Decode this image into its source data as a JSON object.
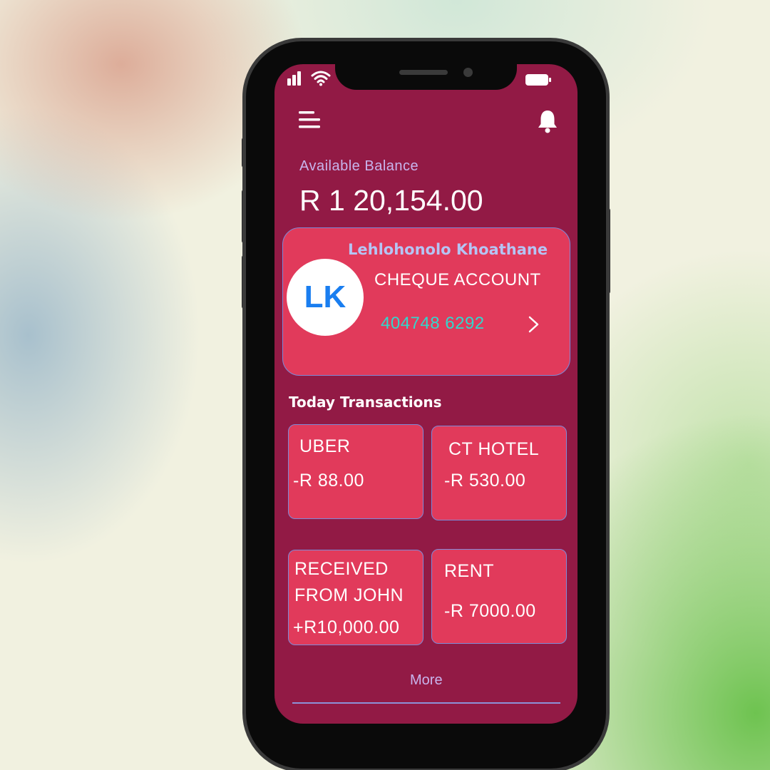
{
  "status_bar": {
    "signal_icon": "signal-bars-icon",
    "wifi_icon": "wifi-icon",
    "battery_icon": "battery-icon"
  },
  "header": {
    "menu_icon": "hamburger-menu-icon",
    "notification_icon": "bell-icon"
  },
  "balance": {
    "label": "Available Balance",
    "amount": "R 1 20,154.00"
  },
  "account": {
    "holder_name": "Lehlohonolo Khoathane",
    "initials": "LK",
    "type": "CHEQUE ACCOUNT",
    "number": "404748 6292",
    "chevron_icon": "chevron-right-icon"
  },
  "transactions": {
    "title": "Today Transactions",
    "items": [
      {
        "name": "UBER",
        "amount": "-R 88.00"
      },
      {
        "name": "CT HOTEL",
        "amount": "-R 530.00"
      },
      {
        "name_line1": "RECEIVED",
        "name_line2": "FROM JOHN",
        "amount": "+R10,000.00"
      },
      {
        "name": "RENT",
        "amount": "-R 7000.00"
      }
    ],
    "more_label": "More"
  },
  "colors": {
    "screen_bg": "#921a45",
    "card_bg": "#e13a5b",
    "card_border": "#7d8ad8",
    "account_number": "#33d6cc",
    "avatar_text": "#1a7ef0",
    "label_lavender": "#c8b4ec"
  }
}
